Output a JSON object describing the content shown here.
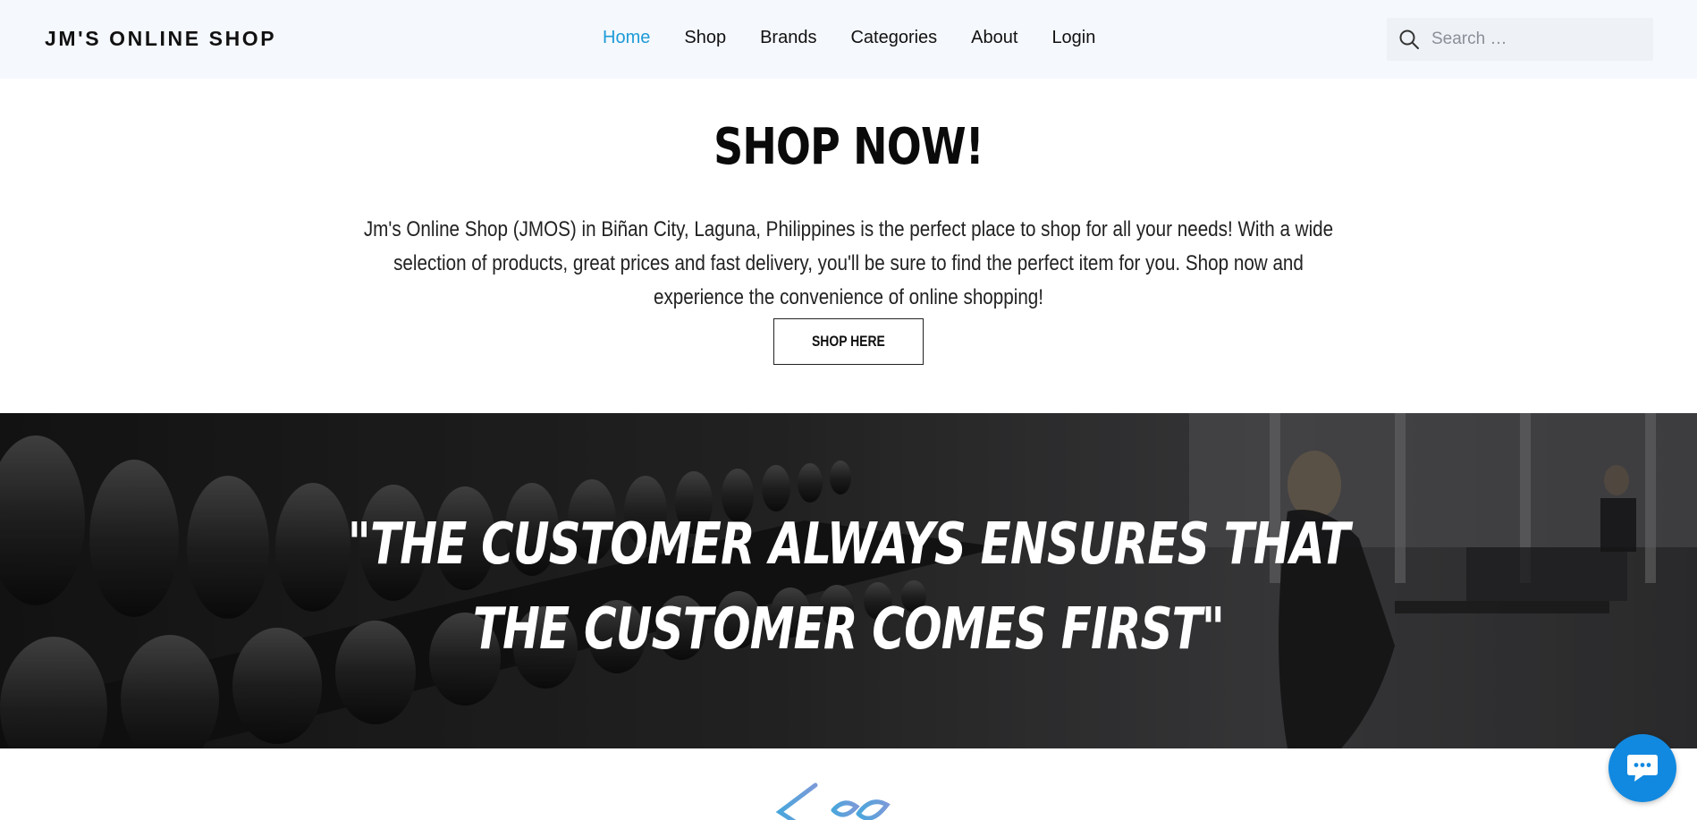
{
  "header": {
    "logo": "JM'S ONLINE SHOP",
    "nav": [
      {
        "label": "Home",
        "active": true
      },
      {
        "label": "Shop",
        "active": false
      },
      {
        "label": "Brands",
        "active": false
      },
      {
        "label": "Categories",
        "active": false
      },
      {
        "label": "About",
        "active": false
      },
      {
        "label": "Login",
        "active": false
      }
    ],
    "search": {
      "placeholder": "Search …",
      "value": ""
    }
  },
  "hero": {
    "title": "SHOP NOW!",
    "description": "Jm's Online Shop (JMOS) in Biñan City, Laguna, Philippines is the perfect place to shop for all your needs! With a wide selection of products, great prices and fast delivery, you'll be sure to find the perfect item for you. Shop now and experience the convenience of online shopping!",
    "button_label": "SHOP HERE"
  },
  "banner": {
    "quote_line1": "\"THE CUSTOMER ALWAYS ENSURES THAT",
    "quote_line2": "THE CUSTOMER COMES FIRST\""
  },
  "colors": {
    "accent": "#1e9bd7",
    "header_bg": "#f5f8fd",
    "chat_button": "#1289e0"
  },
  "icons": {
    "search": "search-icon",
    "chat": "chat-icon"
  }
}
